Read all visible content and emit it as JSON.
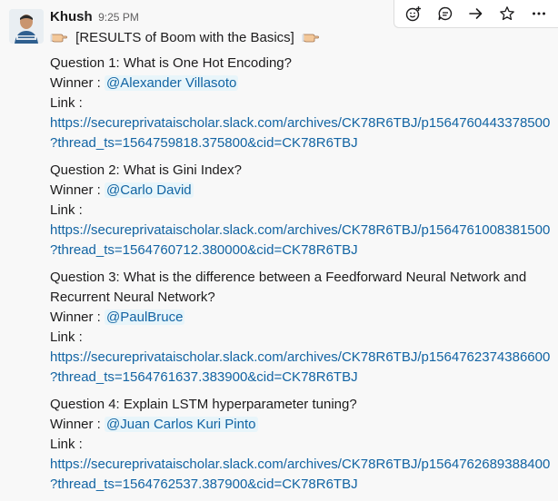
{
  "message": {
    "sender": "Khush",
    "time": "9:25 PM",
    "title": "[RESULTS of Boom with the Basics]",
    "link_label": "Link :",
    "winner_label": "Winner :",
    "questions": [
      {
        "question": "Question 1: What is One Hot Encoding?",
        "winner": "@Alexander Villasoto",
        "url_line1": "https://secureprivataischolar.slack.com/archives/CK78R6TBJ/p1564760443378500",
        "url_line2": "?thread_ts=1564759818.375800&cid=CK78R6TBJ"
      },
      {
        "question": "Question 2: What is Gini Index?",
        "winner": "@Carlo David",
        "url_line1": "https://secureprivataischolar.slack.com/archives/CK78R6TBJ/p1564761008381500",
        "url_line2": "?thread_ts=1564760712.380000&cid=CK78R6TBJ"
      },
      {
        "question_line1": "Question 3: What is the difference between a Feedforward Neural Network and",
        "question_line2": "Recurrent Neural Network?",
        "winner": "@PaulBruce",
        "url_line1": "https://secureprivataischolar.slack.com/archives/CK78R6TBJ/p1564762374386600",
        "url_line2": "?thread_ts=1564761637.383900&cid=CK78R6TBJ"
      },
      {
        "question": "Question 4: Explain LSTM hyperparameter tuning?",
        "winner": "@Juan Carlos Kuri Pinto",
        "url_line1": "https://secureprivataischolar.slack.com/archives/CK78R6TBJ/p1564762689388400",
        "url_line2": "?thread_ts=1564762537.387900&cid=CK78R6TBJ"
      }
    ]
  },
  "toolbar": {
    "icons": [
      "add-reaction-icon",
      "reply-thread-icon",
      "share-icon",
      "star-icon",
      "more-actions-icon"
    ]
  },
  "colors": {
    "link": "#1264a3",
    "mention_bg": "#e8f5fa",
    "background": "#f8f8f8"
  }
}
